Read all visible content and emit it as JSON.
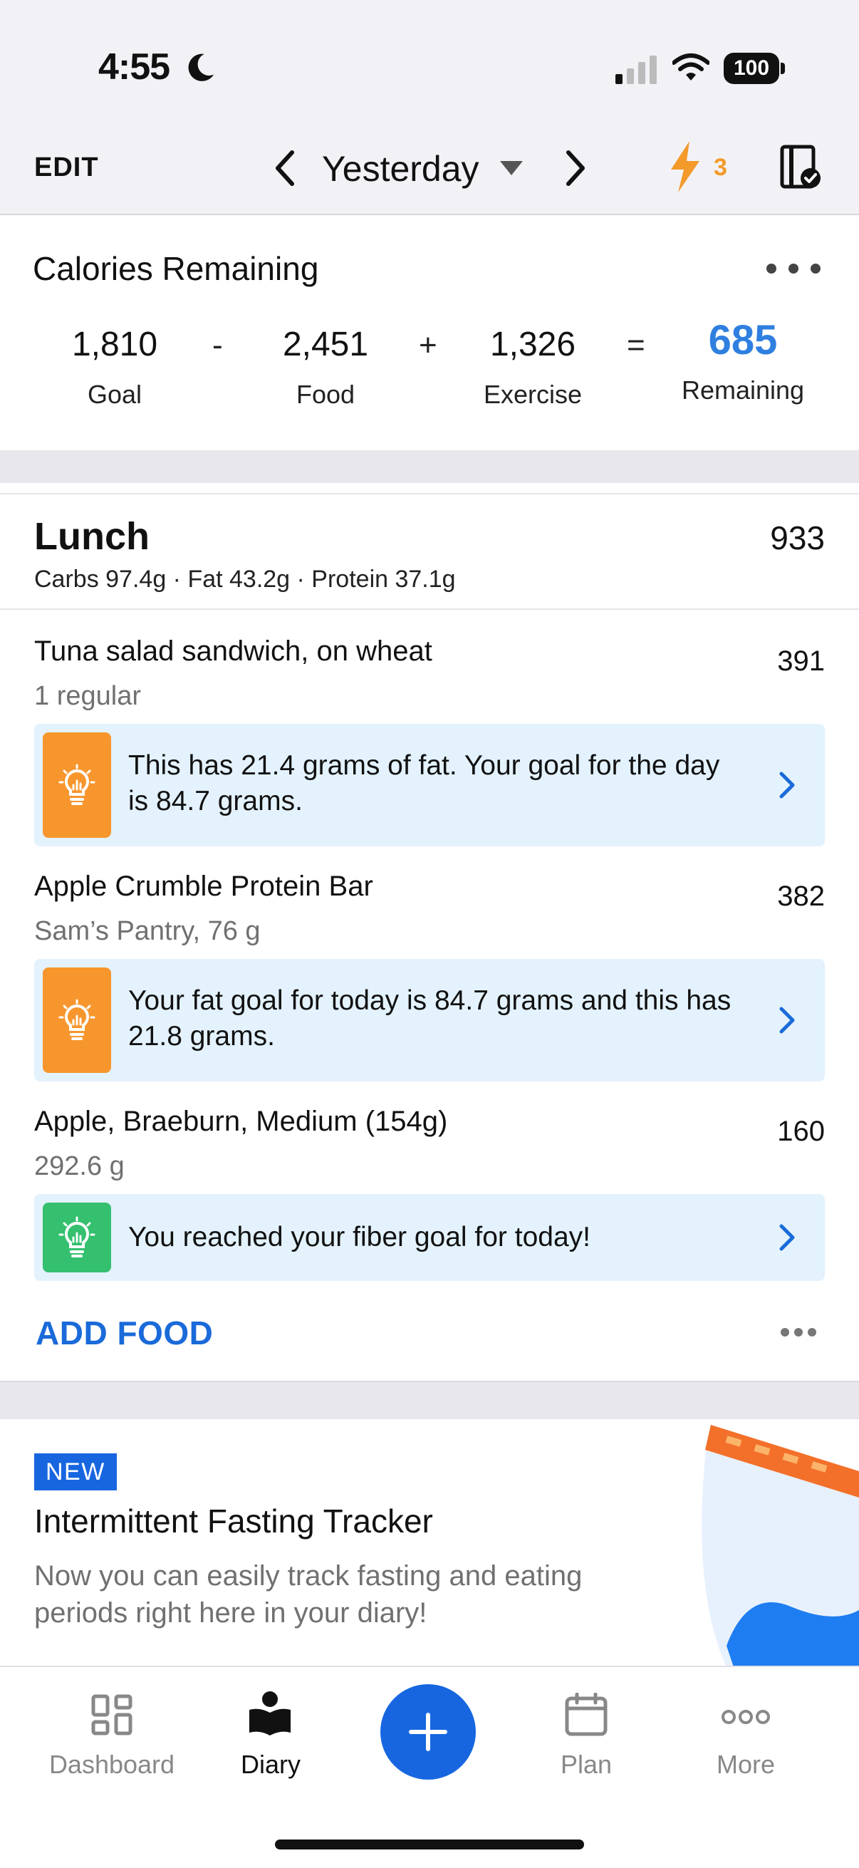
{
  "status_bar": {
    "time": "4:55",
    "battery": "100"
  },
  "header": {
    "edit_label": "EDIT",
    "day_label": "Yesterday",
    "streak_count": "3",
    "streak_color": "#f39a2b"
  },
  "calories": {
    "title": "Calories Remaining",
    "goal": {
      "value": "1,810",
      "label": "Goal"
    },
    "food": {
      "value": "2,451",
      "label": "Food"
    },
    "exercise": {
      "value": "1,326",
      "label": "Exercise"
    },
    "remaining": {
      "value": "685",
      "label": "Remaining"
    },
    "op_minus": "-",
    "op_plus": "+",
    "op_equals": "=",
    "remaining_color": "#2f7fe0"
  },
  "meal": {
    "title": "Lunch",
    "total": "933",
    "macros": "Carbs 97.4g · Fat 43.2g · Protein 37.1g",
    "items": [
      {
        "name": "Tuna salad sandwich, on wheat",
        "detail": "1 regular",
        "calories": "391",
        "tip": "This has 21.4 grams of fat. Your goal for the day is 84.7 grams.",
        "tip_color": "#f7962d"
      },
      {
        "name": "Apple Crumble Protein Bar",
        "detail": "Sam’s Pantry, 76 g",
        "calories": "382",
        "tip": "Your fat goal for today is 84.7 grams and this has 21.8 grams.",
        "tip_color": "#f7962d"
      },
      {
        "name": "Apple, Braeburn, Medium (154g)",
        "detail": "292.6 g",
        "calories": "160",
        "tip": "You reached your fiber goal for today!",
        "tip_color": "#34c06e"
      }
    ],
    "add_food_label": "ADD FOOD"
  },
  "promo": {
    "badge": "NEW",
    "title": "Intermittent Fasting Tracker",
    "body": "Now you can easily track fasting and eating periods right here in your diary!"
  },
  "tabs": [
    {
      "label": "Dashboard",
      "icon": "dashboard-grid-icon"
    },
    {
      "label": "Diary",
      "icon": "diary-book-icon",
      "active": true
    },
    {
      "label": "Plan",
      "icon": "calendar-icon"
    },
    {
      "label": "More",
      "icon": "more-dots-icon"
    }
  ],
  "colors": {
    "accent": "#1766e0",
    "tip_bg": "#e3f2fd",
    "muted": "#707070"
  }
}
